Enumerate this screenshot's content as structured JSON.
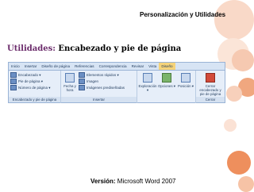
{
  "slide": {
    "header_title": "Personalización y Utilidades",
    "heading_lead": "Utilidades:",
    "heading_rest": " Encabezado y pie de página",
    "footer_label": "Versión:",
    "footer_value": " Microsoft Word 2007"
  },
  "ribbon": {
    "tabs": [
      "Inicio",
      "Insertar",
      "Diseño de página",
      "Referencias",
      "Correspondencia",
      "Revisar",
      "Vista",
      "Diseño"
    ],
    "active_tab_index": 7,
    "group_header_footer": {
      "items": [
        "Encabezado ▾",
        "Pie de página ▾",
        "Número de página ▾"
      ],
      "label": "Encabezado y pie de página"
    },
    "group_insert": {
      "fecha_hora": "Fecha y hora",
      "items": [
        "Elementos rápidos ▾",
        "Imagen",
        "Imágenes prediseñadas"
      ],
      "label": "Insertar"
    },
    "navigation": {
      "label": "Exploración ▾"
    },
    "options": {
      "label": "Opciones ▾"
    },
    "position": {
      "label": "Posición ▾"
    },
    "close_group": {
      "button_label": "Cerrar encabezado y pie de página",
      "label": "Cerrar"
    }
  }
}
